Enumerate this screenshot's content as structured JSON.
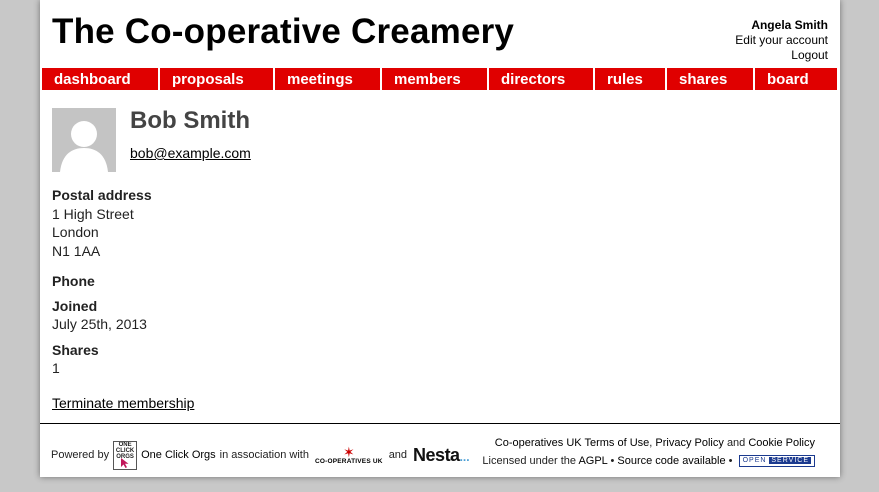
{
  "header": {
    "site_title": "The Co-operative Creamery",
    "user_name": "Angela Smith",
    "edit_account": "Edit your account",
    "logout": "Logout"
  },
  "nav": {
    "items": [
      {
        "label": "dashboard"
      },
      {
        "label": "proposals"
      },
      {
        "label": "meetings"
      },
      {
        "label": "members"
      },
      {
        "label": "directors"
      },
      {
        "label": "rules"
      },
      {
        "label": "shares"
      },
      {
        "label": "board"
      }
    ],
    "color": "#e00000"
  },
  "member": {
    "name": "Bob Smith",
    "email": "bob@example.com",
    "postal_label": "Postal address",
    "address": [
      "1 High Street",
      "London",
      "N1 1AA"
    ],
    "phone_label": "Phone",
    "joined_label": "Joined",
    "joined": "July 25th, 2013",
    "shares_label": "Shares",
    "shares": "1",
    "terminate": "Terminate membership"
  },
  "footer": {
    "powered_by": "Powered by",
    "oco_logo_text": "ONE CLICK ORGS",
    "oco_name": "One Click Orgs",
    "association": "in association with",
    "coops_logo_text": "CO-OPERATIVES UK",
    "and": "and",
    "nesta": "Nesta",
    "nesta_dots": "...",
    "coops_uk": "Co-operatives UK",
    "terms": "Terms of Use",
    "privacy": "Privacy Policy",
    "and2": "and",
    "cookie": "Cookie Policy",
    "licensed": "Licensed under the",
    "agpl": "AGPL",
    "source": "Source code available",
    "open_service_open": "OPEN",
    "open_service_service": "SERVICE"
  }
}
